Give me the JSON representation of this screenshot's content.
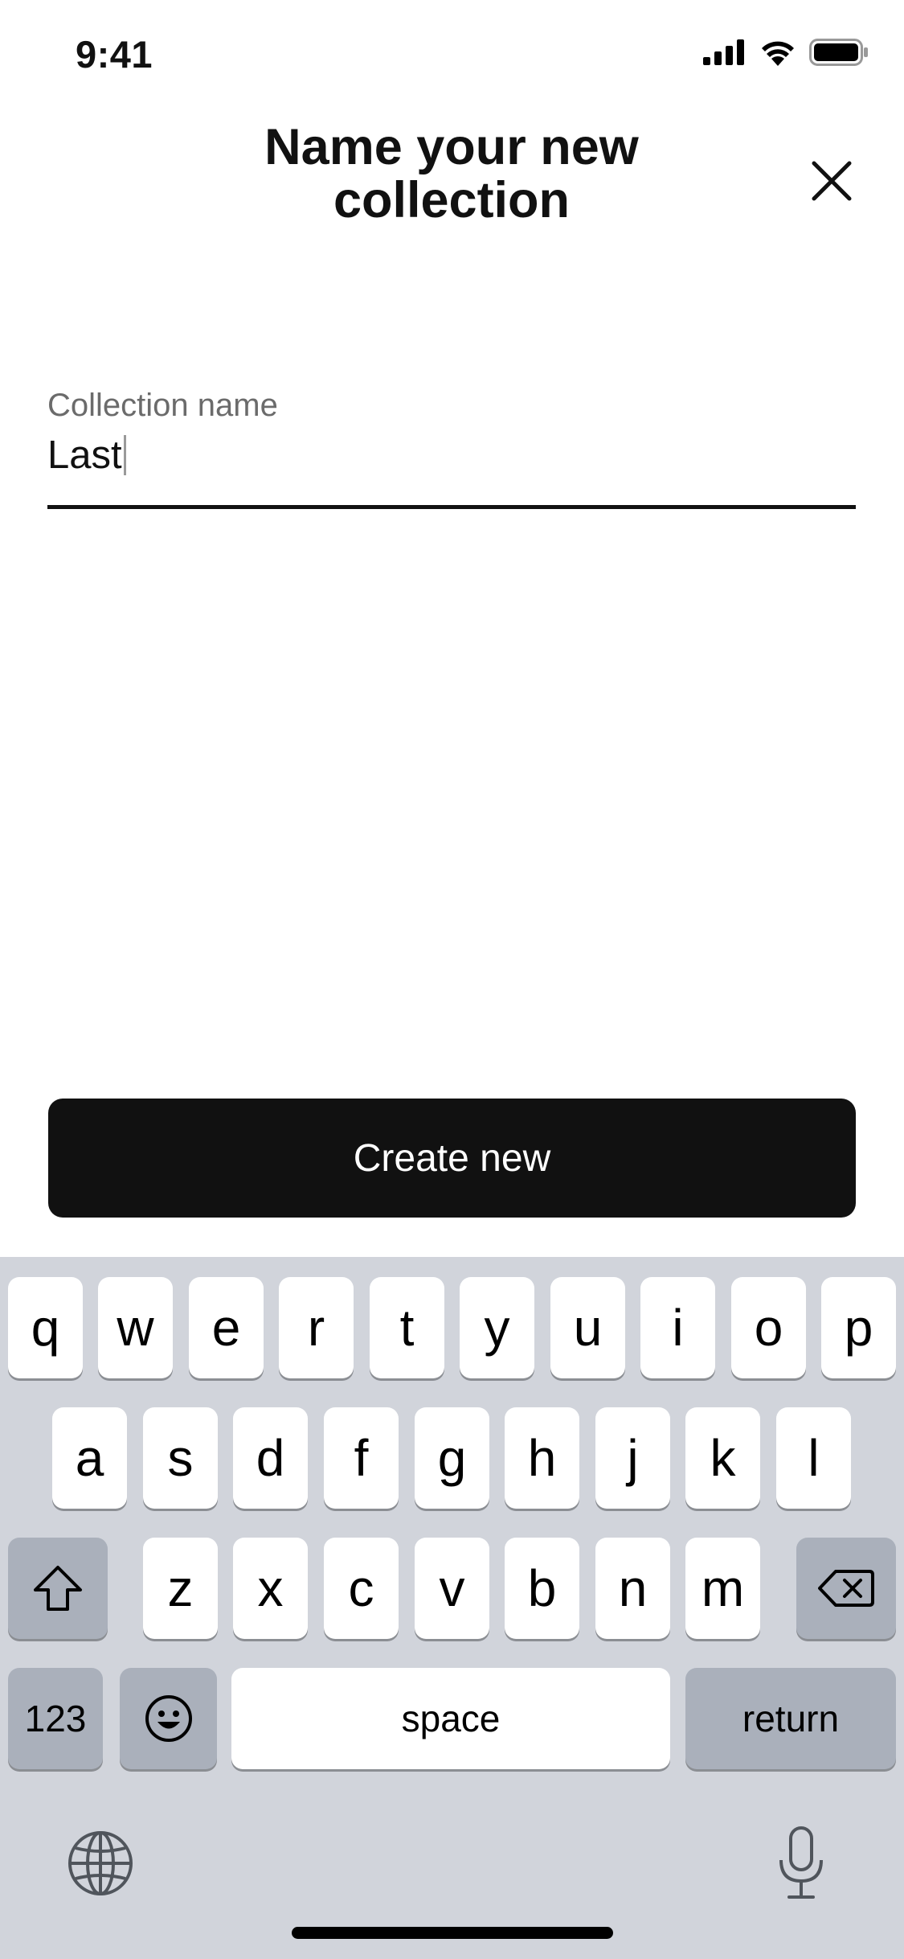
{
  "status_bar": {
    "time": "9:41",
    "icons": [
      "cellular-signal-icon",
      "wifi-icon",
      "battery-icon"
    ]
  },
  "header": {
    "title": "Name your new collection",
    "close_icon": "close-icon"
  },
  "form": {
    "label": "Collection name",
    "value": "Last"
  },
  "primary_button": {
    "label": "Create new"
  },
  "keyboard": {
    "row1": [
      "q",
      "w",
      "e",
      "r",
      "t",
      "y",
      "u",
      "i",
      "o",
      "p"
    ],
    "row2": [
      "a",
      "s",
      "d",
      "f",
      "g",
      "h",
      "j",
      "k",
      "l"
    ],
    "row3": [
      "z",
      "x",
      "c",
      "v",
      "b",
      "n",
      "m"
    ],
    "numbers_label": "123",
    "space_label": "space",
    "return_label": "return",
    "icons": [
      "shift-icon",
      "delete-icon",
      "emoji-icon",
      "globe-icon",
      "microphone-icon"
    ]
  },
  "colors": {
    "text": "#111111",
    "label": "#6b6b6b",
    "button_bg": "#111111",
    "keyboard_bg": "#d1d4db",
    "key_dark": "#aab0bb"
  }
}
